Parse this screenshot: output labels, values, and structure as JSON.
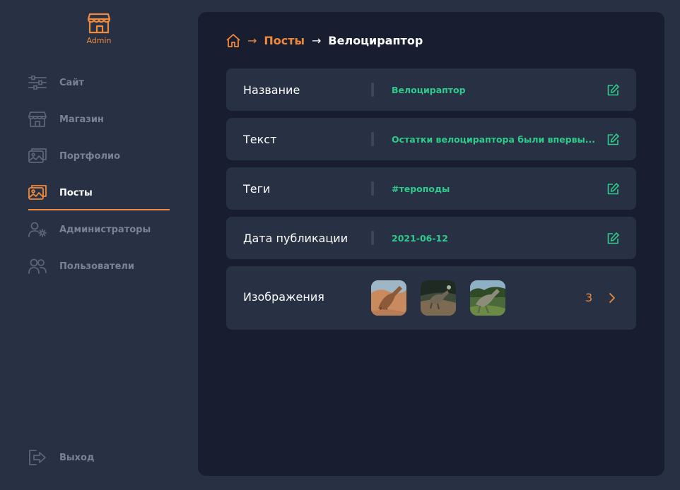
{
  "sidebar": {
    "logo_label": "Admin",
    "logo_icon": "storefront-icon",
    "items": [
      {
        "label": "Сайт",
        "icon": "sliders-icon"
      },
      {
        "label": "Магазин",
        "icon": "store-icon"
      },
      {
        "label": "Портфолио",
        "icon": "gallery-icon"
      },
      {
        "label": "Посты",
        "icon": "posts-gallery-icon",
        "active": true
      },
      {
        "label": "Администраторы",
        "icon": "admin-user-icon"
      },
      {
        "label": "Пользователи",
        "icon": "users-icon"
      }
    ],
    "logout_label": "Выход",
    "logout_icon": "logout-icon"
  },
  "breadcrumb": {
    "home_icon": "home-icon",
    "posts": "Посты",
    "current": "Велоцираптор"
  },
  "fields": [
    {
      "label": "Название",
      "value": "Велоцираптор"
    },
    {
      "label": "Текст",
      "value": "Остатки велоцираптора были впервы..."
    },
    {
      "label": "Теги",
      "value": "#тероподы"
    },
    {
      "label": "Дата публикации",
      "value": "2021-06-12"
    }
  ],
  "images": {
    "label": "Изображения",
    "count": "3",
    "thumbnails": [
      "velociraptor-sketch",
      "velociraptor-jungle",
      "velociraptor-forest"
    ]
  },
  "colors": {
    "accent": "#f08a3c",
    "value_green": "#2ecb8b",
    "sidebar_bg": "#283044",
    "panel_bg": "#181d2f",
    "row_bg": "#283044"
  }
}
